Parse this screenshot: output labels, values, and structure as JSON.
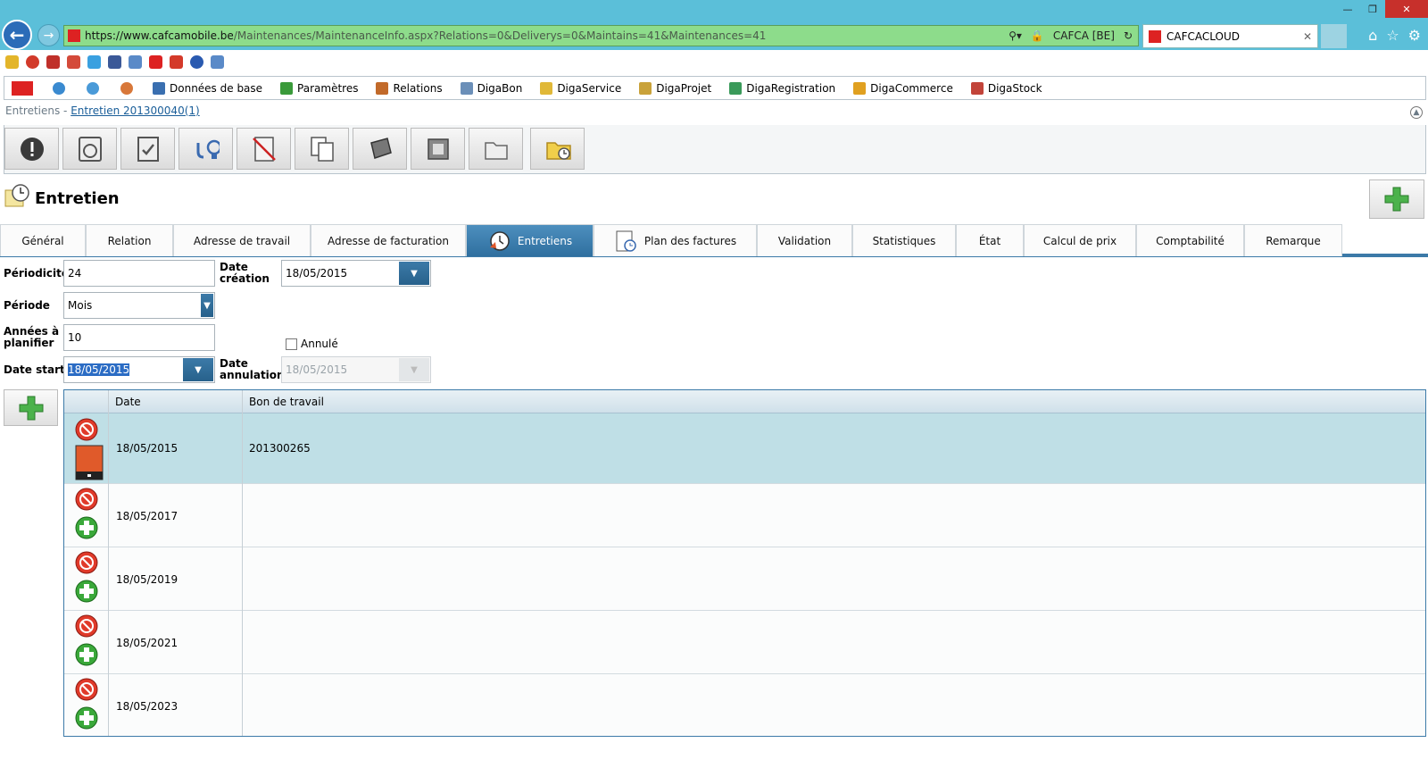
{
  "browser": {
    "url_host": "https://www.cafcamobile.be",
    "url_path": "/Maintenances/MaintenanceInfo.aspx?Relations=0&Deliverys=0&Maintains=41&Maintenances=41",
    "site_identity": "CAFCA [BE]",
    "tab_title": "CAFCACLOUD"
  },
  "menu": {
    "items": [
      {
        "label": "Données de base",
        "icon": "database-icon",
        "color": "#3a6fb0"
      },
      {
        "label": "Paramètres",
        "icon": "settings-icon",
        "color": "#3a9a3a"
      },
      {
        "label": "Relations",
        "icon": "relations-icon",
        "color": "#c26a2a"
      },
      {
        "label": "DigaBon",
        "icon": "digabon-icon",
        "color": "#6b8fb8"
      },
      {
        "label": "DigaService",
        "icon": "digaservice-icon",
        "color": "#e0b838"
      },
      {
        "label": "DigaProjet",
        "icon": "digaprojet-icon",
        "color": "#c9a23a"
      },
      {
        "label": "DigaRegistration",
        "icon": "digaregistration-icon",
        "color": "#3a9a5a"
      },
      {
        "label": "DigaCommerce",
        "icon": "digacommerce-icon",
        "color": "#e0a020"
      },
      {
        "label": "DigaStock",
        "icon": "digastock-icon",
        "color": "#c2443a"
      }
    ]
  },
  "breadcrumb": {
    "parent": "Entretiens",
    "separator": " - ",
    "current": "Entretien 201300040(1)"
  },
  "page": {
    "title": "Entretien"
  },
  "tabs": [
    {
      "label": "Général"
    },
    {
      "label": "Relation"
    },
    {
      "label": "Adresse de travail"
    },
    {
      "label": "Adresse de facturation"
    },
    {
      "label": "Entretiens"
    },
    {
      "label": "Plan des factures"
    },
    {
      "label": "Validation"
    },
    {
      "label": "Statistiques"
    },
    {
      "label": "État"
    },
    {
      "label": "Calcul de prix"
    },
    {
      "label": "Comptabilité"
    },
    {
      "label": "Remarque"
    }
  ],
  "form": {
    "periodicite_label": "Périodicité",
    "periodicite_value": "24",
    "date_creation_label_1": "Date",
    "date_creation_label_2": "création",
    "date_creation_value": "18/05/2015",
    "periode_label": "Période",
    "periode_value": "Mois",
    "annees_label_1": "Années à",
    "annees_label_2": "planifier",
    "annees_value": "10",
    "annule_label": "Annulé",
    "date_start_label": "Date start",
    "date_start_value": "18/05/2015",
    "date_annulation_label_1": "Date",
    "date_annulation_label_2": "annulation",
    "date_annulation_value": "18/05/2015"
  },
  "grid": {
    "columns": {
      "date": "Date",
      "bon": "Bon de travail"
    },
    "rows": [
      {
        "date": "18/05/2015",
        "bon": "201300265"
      },
      {
        "date": "18/05/2017",
        "bon": ""
      },
      {
        "date": "18/05/2019",
        "bon": ""
      },
      {
        "date": "18/05/2021",
        "bon": ""
      },
      {
        "date": "18/05/2023",
        "bon": ""
      }
    ]
  },
  "colors": {
    "accent": "#3c7aa8",
    "selected_row": "#bfdfe6",
    "browser_chrome": "#5bbfd9",
    "address_bar": "#8ddc8b"
  }
}
